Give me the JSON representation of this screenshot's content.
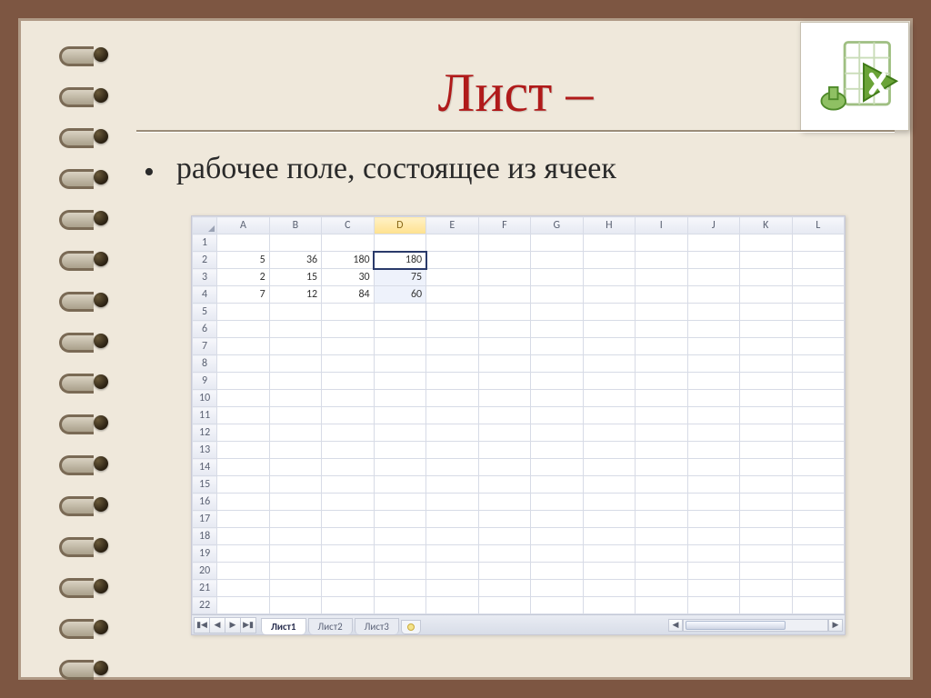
{
  "slide": {
    "title": "Лист –",
    "bullet": "рабочее поле, состоящее из ячеек"
  },
  "spreadsheet": {
    "columns": [
      "A",
      "B",
      "C",
      "D",
      "E",
      "F",
      "G",
      "H",
      "I",
      "J",
      "K",
      "L"
    ],
    "active_column": "D",
    "row_count": 22,
    "data": {
      "2": {
        "A": 5,
        "B": 36,
        "C": 180,
        "D": 180
      },
      "3": {
        "A": 2,
        "B": 15,
        "C": 30,
        "D": 75
      },
      "4": {
        "A": 7,
        "B": 12,
        "C": 84,
        "D": 60
      }
    },
    "selection": {
      "col": "D",
      "rows": [
        2,
        3,
        4
      ]
    },
    "tabs": [
      "Лист1",
      "Лист2",
      "Лист3"
    ],
    "active_tab": "Лист1"
  },
  "logo_alt": "excel-icon"
}
